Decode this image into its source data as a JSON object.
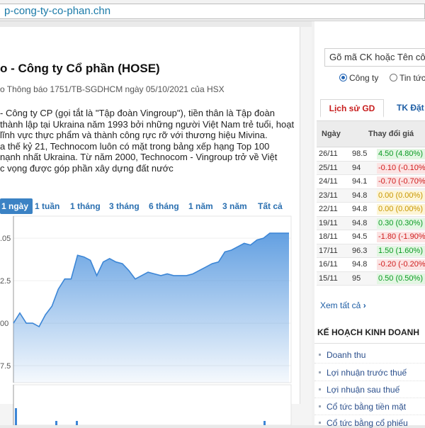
{
  "browser": {
    "url": "p-cong-ty-co-phan.chn"
  },
  "company": {
    "title": "o - Công ty Cổ phần (HOSE)",
    "subtitle": "o Thông báo 1751/TB-SGDHCM ngày 05/10/2021 của HSX",
    "description": [
      "- Công ty CP (gọi tắt là \"Tập đoàn Vingroup\"), tiền thân là Tập đoàn",
      "thành lập tại Ukraina năm 1993 bởi những người Việt Nam trẻ tuổi, hoạt",
      "lĩnh vực thực phẩm và thành công rực rỡ với thương hiệu Mivina.",
      "a thế kỷ 21, Technocom luôn có mặt trong bảng xếp hạng Top 100",
      "nạnh nhất Ukraina. Từ năm 2000, Technocom - Vingroup trở về Việt",
      "c vọng được góp phần xây dựng đất nước"
    ]
  },
  "ranges": [
    "1 ngày",
    "1 tuần",
    "1 tháng",
    "3 tháng",
    "6 tháng",
    "1 năm",
    "3 năm",
    "Tất cả"
  ],
  "chart_data": {
    "type": "area",
    "y_tick_labels": [
      ".05",
      "2.5",
      "00",
      "7.5"
    ],
    "y_ticks": [
      95,
      92.5,
      90,
      87.5
    ],
    "ylim": [
      86.5,
      96.3
    ],
    "values": [
      90,
      90.6,
      90,
      90,
      89.8,
      90.5,
      91,
      92,
      92.6,
      92.6,
      94,
      93.9,
      93.7,
      92.8,
      93.6,
      93.8,
      93.6,
      93.5,
      93.1,
      92.6,
      92.8,
      93,
      92.9,
      92.8,
      92.9,
      92.8,
      92.8,
      92.8,
      92.9,
      93.1,
      93.3,
      93.5,
      93.6,
      94.2,
      94.3,
      94.5,
      94.7,
      94.6,
      94.9,
      95,
      95.3,
      95.3,
      95.3,
      95.3
    ],
    "color": "#5b9be0"
  },
  "search": {
    "placeholder": "Gõ mã CK hoặc Tên cô"
  },
  "radios": [
    {
      "label": "Công ty",
      "selected": true
    },
    {
      "label": "Tin tức",
      "selected": false
    }
  ],
  "tabs": {
    "active": "Lịch sử GD",
    "other": "TK Đặt"
  },
  "history": {
    "headers": {
      "date": "Ngày",
      "change": "Thay đổi giá"
    },
    "rows": [
      {
        "date": "26/11",
        "price": "98.5",
        "change": "4.50 (4.80%)",
        "dir": "up"
      },
      {
        "date": "25/11",
        "price": "94",
        "change": "-0.10 (-0.10%)",
        "dir": "down"
      },
      {
        "date": "24/11",
        "price": "94.1",
        "change": "-0.70 (-0.70%)",
        "dir": "down"
      },
      {
        "date": "23/11",
        "price": "94.8",
        "change": "0.00 (0.00%)",
        "dir": "flat"
      },
      {
        "date": "22/11",
        "price": "94.8",
        "change": "0.00 (0.00%)",
        "dir": "flat"
      },
      {
        "date": "19/11",
        "price": "94.8",
        "change": "0.30 (0.30%)",
        "dir": "up"
      },
      {
        "date": "18/11",
        "price": "94.5",
        "change": "-1.80 (-1.90%)",
        "dir": "down"
      },
      {
        "date": "17/11",
        "price": "96.3",
        "change": "1.50 (1.60%)",
        "dir": "up"
      },
      {
        "date": "16/11",
        "price": "94.8",
        "change": "-0.20 (-0.20%)",
        "dir": "down"
      },
      {
        "date": "15/11",
        "price": "95",
        "change": "0.50 (0.50%)",
        "dir": "up"
      }
    ],
    "see_all": "Xem tất cả"
  },
  "plan": {
    "title": "KẾ HOẠCH KINH DOANH",
    "items": [
      "Doanh thu",
      "Lợi nhuận trước thuế",
      "Lợi nhuận sau thuế",
      "Cổ tức bằng tiền mặt",
      "Cổ tức bằng cổ phiếu"
    ]
  },
  "colors": {
    "up": "#0a9b22",
    "down": "#d01c1c",
    "flat": "#c89600",
    "up_bg": "#e3f6e3",
    "down_bg": "#fbe3e3",
    "flat_bg": "#fdf5d6"
  }
}
